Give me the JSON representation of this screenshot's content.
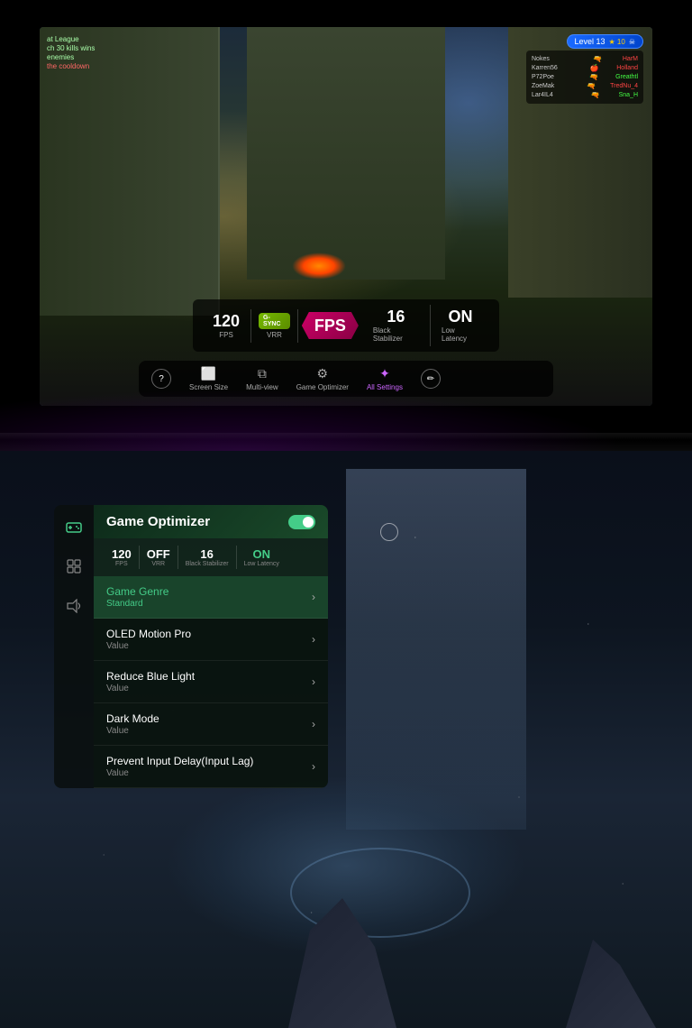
{
  "top": {
    "hud": {
      "level": "Level 13",
      "stars": "★ 10",
      "skull": "☠",
      "scoreboard": [
        {
          "name": "Nokes",
          "gun": "🔫",
          "score": "HarM",
          "color": "red"
        },
        {
          "name": "Karren56",
          "gun": "🍎",
          "score": "Holland",
          "color": "red"
        },
        {
          "name": "P72Poe",
          "gun": "🔫",
          "score": "Greathtl",
          "color": "green"
        },
        {
          "name": "ZoeMak",
          "gun": "🔫",
          "score": "TredNu_4",
          "color": "red"
        },
        {
          "name": "Lar4IL4",
          "gun": "🔫",
          "score": "Sna_H",
          "color": "green"
        }
      ],
      "left_lines": [
        "at League",
        "ch 30 kills wins",
        "enemies",
        "the cooldown"
      ]
    },
    "stats_bar": {
      "fps_value": "120",
      "fps_label": "FPS",
      "gsync_label": "G-SYNC",
      "vrr_label": "VRR",
      "center_label": "FPS",
      "black_stab_value": "16",
      "black_stab_label": "Black Stabilizer",
      "low_latency_value": "ON",
      "low_latency_label": "Low Latency"
    },
    "bottom_menu": {
      "help": "?",
      "screen_size_label": "Screen Size",
      "multi_view_label": "Multi-view",
      "optimizer_label": "Game Optimizer",
      "settings_label": "All Settings",
      "edit": "✏"
    }
  },
  "bottom": {
    "panel": {
      "title": "Game Optimizer",
      "toggle_state": "ON",
      "mini_stats": [
        {
          "value": "120",
          "label": "FPS"
        },
        {
          "value": "OFF",
          "label": "VRR"
        },
        {
          "value": "16",
          "label": "Black Stabilizer"
        },
        {
          "value": "ON",
          "label": "Low Latency"
        }
      ],
      "menu_items": [
        {
          "title": "Game Genre",
          "value": "Standard",
          "highlighted": true
        },
        {
          "title": "OLED Motion Pro",
          "value": "Value",
          "highlighted": false
        },
        {
          "title": "Reduce Blue Light",
          "value": "Value",
          "highlighted": false
        },
        {
          "title": "Dark Mode",
          "value": "Value",
          "highlighted": false
        },
        {
          "title": "Prevent Input Delay(Input Lag)",
          "value": "Value",
          "highlighted": false
        }
      ]
    },
    "sidebar_icons": [
      {
        "icon": "🎮",
        "label": "game-icon",
        "active": true
      },
      {
        "icon": "⊞",
        "label": "grid-icon",
        "active": false
      },
      {
        "icon": "🔊",
        "label": "volume-icon",
        "active": false
      }
    ]
  }
}
